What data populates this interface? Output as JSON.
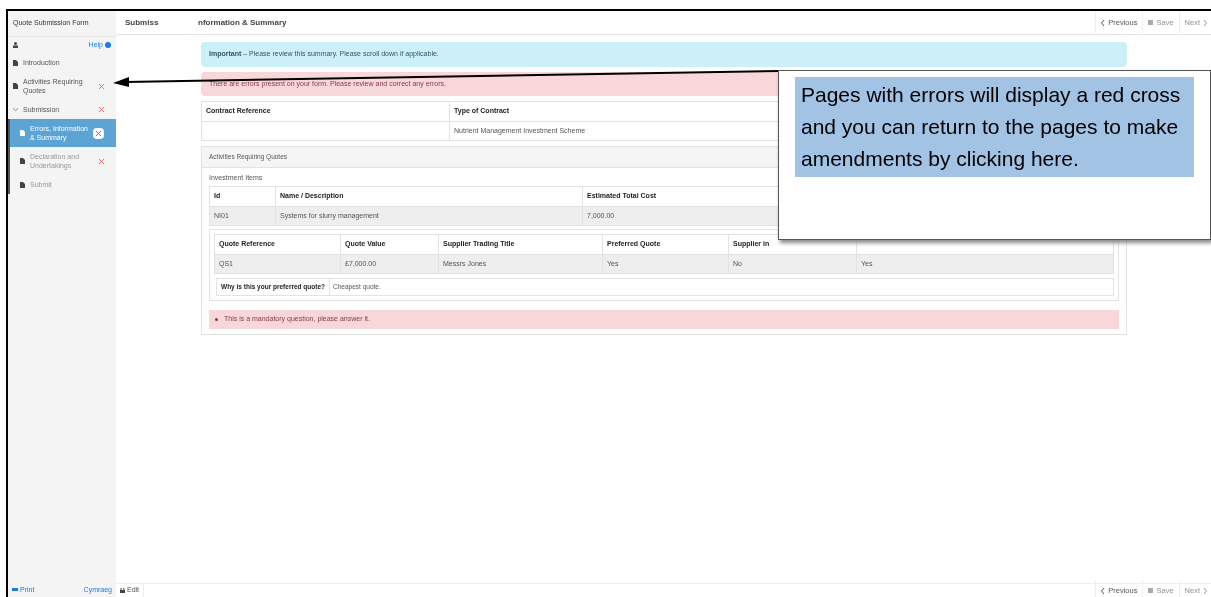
{
  "sidebar": {
    "title": "Quote Submission Form",
    "help": "Help",
    "items": [
      {
        "label": "Introduction",
        "kind": "page",
        "error": false,
        "selected": false,
        "disabled": false
      },
      {
        "label": "Activities Requiring Quotes",
        "kind": "page",
        "error": true,
        "selected": false,
        "disabled": false
      },
      {
        "label": "Submission",
        "kind": "group",
        "expanded": true,
        "error": true,
        "selected": false,
        "disabled": false,
        "children": [
          {
            "label": "Errors, Information & Summary",
            "kind": "page",
            "error": true,
            "selected": true,
            "disabled": false
          },
          {
            "label": "Declaration and Undertakings",
            "kind": "page",
            "error": true,
            "selected": false,
            "disabled": true
          },
          {
            "label": "Submit",
            "kind": "page",
            "error": false,
            "selected": false,
            "disabled": true
          }
        ]
      }
    ],
    "footer": {
      "print": "Print",
      "language": "Cymraeg"
    }
  },
  "header": {
    "title_start": "Submiss",
    "title_end": "nformation & Summary",
    "buttons": [
      {
        "label": "Previous",
        "disabled": false
      },
      {
        "label": "Save",
        "disabled": true
      },
      {
        "label": "Next",
        "disabled": true
      }
    ]
  },
  "alerts": [
    {
      "kind": "info",
      "bold": "Important",
      "text": " – Please review this summary. Please scroll down if applicable."
    },
    {
      "kind": "error",
      "text": "There are errors present on your form. Please review and correct any errors."
    }
  ],
  "contract_table": {
    "columns": [
      "Contract Reference",
      "Type of Contract"
    ],
    "rows": [
      [
        "",
        "Nutrient Management Investment Scheme"
      ]
    ]
  },
  "activities": {
    "title": "Activities Requiring Quotes",
    "subtitle": "Investment Items",
    "items_table": {
      "columns": [
        "Id",
        "Name / Description",
        "Estimated Total Cost"
      ],
      "rows": [
        [
          "NI01",
          "Systems for slurry management",
          "7,000.00"
        ]
      ]
    },
    "quotes_table": {
      "columns": [
        "Quote Reference",
        "Quote Value",
        "Supplier Trading Title",
        "Preferred Quote",
        "Supplier in",
        ""
      ],
      "rows": [
        [
          "QS1",
          "£7,000.00",
          "Messrs Jones",
          "Yes",
          "No",
          "Yes"
        ]
      ]
    },
    "question": {
      "label": "Why is this your preferred quote?",
      "answer": "Cheapest quote."
    },
    "validation": "This is a mandatory question, please answer it."
  },
  "footer_bar": {
    "edit": "Edit",
    "buttons": [
      {
        "label": "Previous",
        "disabled": false
      },
      {
        "label": "Save",
        "disabled": true
      },
      {
        "label": "Next",
        "disabled": true
      }
    ]
  },
  "callout": {
    "text": "Pages with errors will display a red cross and you can return to the pages to make amendments by clicking here."
  }
}
